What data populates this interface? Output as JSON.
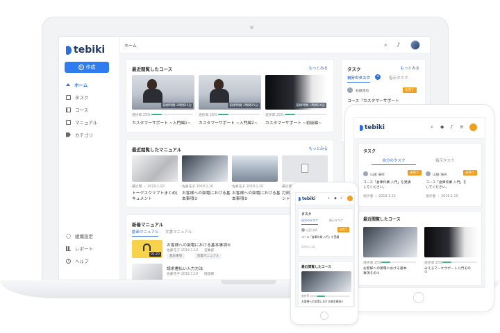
{
  "laptop": {
    "logo": "tebiki",
    "create_button": "作成",
    "nav": [
      {
        "label": "ホーム",
        "icon": "home-icon"
      },
      {
        "label": "タスク",
        "icon": "calendar-icon"
      },
      {
        "label": "コース",
        "icon": "course-icon"
      },
      {
        "label": "マニュアル",
        "icon": "manual-icon"
      },
      {
        "label": "カテゴリ",
        "icon": "tag-icon"
      }
    ],
    "nav_bottom": [
      {
        "label": "組織設定",
        "icon": "gear-icon"
      },
      {
        "label": "レポート",
        "icon": "report-icon"
      },
      {
        "label": "ヘルプ",
        "icon": "help-icon"
      }
    ],
    "breadcrumb": "ホーム",
    "recent_courses": {
      "title": "最近閲覧したコース",
      "more": "もっとみる",
      "items": [
        {
          "tag": "研修時間 2時間25分",
          "progress_label": "進捗率 25%",
          "progress": 0.25,
          "title": "カスタマーサポート ~入門編1~"
        },
        {
          "tag": "研修時間 2時間25分",
          "progress_label": "進捗率 25%",
          "progress": 0.25,
          "title": "カスタマーサポート ~入門編2~"
        },
        {
          "tag": "研修時間 3時間20分",
          "progress_label": "進捗率 25%",
          "progress": 0.25,
          "title": "カスタマーサポート ~初級編~"
        }
      ]
    },
    "recent_manuals": {
      "title": "最近閲覧したマニュアル",
      "more": "もっとみる",
      "items": [
        {
          "meta": "最近閲 ・ 2019.1.10",
          "title_l1": "トークスクリプトまとめ(",
          "title_l2": "キュメント"
        },
        {
          "meta": "佐藤花子 2019.1.10",
          "title_l1": "お客様への架電における基",
          "title_l2": "本事項①"
        },
        {
          "meta": "佐藤花子 2019.1.10",
          "title_l1": "お客様への架電における基",
          "title_l2": "本事項②"
        },
        {
          "meta": "最近閲",
          "title_l1": "打刻",
          "title_l2": "シャ"
        }
      ]
    },
    "new_manuals": {
      "title": "新着マニュアル",
      "tabs": [
        "動画マニュアル",
        "文書マニュアル"
      ],
      "items": [
        {
          "title": "お客様への架電における基本事項④",
          "meta": "佐藤花子 2019.1.10",
          "dept": "営業部",
          "chips": [
            "基本事項",
            "架電マニュアル"
          ],
          "duration": "01:25"
        },
        {
          "title": "請求書払い入力方法",
          "meta": "佐藤花子 2019.1.10",
          "dept": "経理部",
          "chips": [],
          "duration": ""
        }
      ]
    },
    "tasks": {
      "title": "タスク",
      "more": "もっとみる",
      "tabs": [
        "自分のタスク",
        "指示タスク"
      ],
      "badge": "4",
      "item": {
        "name": "石田達也",
        "status": "未完了",
        "text": "コース「カスタマーサポート"
      }
    }
  },
  "tablet": {
    "logo": "tebiki",
    "task_title": "タスク",
    "tabs": [
      "自分のタスク",
      "指示タスク"
    ],
    "tasks": [
      {
        "name": "山田 浩司",
        "status": "未完了",
        "text_l1": "コース「倉庫作業 入門」を受講",
        "text_l2": "してください。",
        "meta": "指示者 ・ 2019.1.10"
      },
      {
        "name": "山田 浩司",
        "status": "未完了",
        "text_l1": "コース「倉庫作業 入門」を",
        "text_l2": "してください。",
        "meta": "指示者 ・ 2019.1.10"
      }
    ],
    "recent_title": "最近閲覧したコース",
    "courses": [
      {
        "progress_label": "進捗率 25%",
        "progress": 0.25,
        "title_l1": "お客様への架電における基本",
        "title_l2": "事項その①"
      },
      {
        "progress_label": "進捗率 25%",
        "progress": 0.25,
        "title_l1": "みえるマーケサポート入門その",
        "title_l2": "①"
      }
    ]
  },
  "phone": {
    "logo": "tebiki",
    "task_title": "タスク",
    "tabs": [
      "自分のタスク",
      "指示タスク"
    ],
    "task": {
      "name": "山田 浩司",
      "status": "未完了",
      "text": "コース「倉庫作業 入門」を受講",
      "meta": "2019.1.10"
    },
    "recent_title": "最近閲覧したコース",
    "course": {
      "progress_label": "進捗率 25%",
      "progress": 0.25,
      "title": "お客様への架電における基本事項②"
    }
  },
  "colors": {
    "accent": "#2f6ee0",
    "success": "#37b37e",
    "warning": "#f0a020"
  }
}
